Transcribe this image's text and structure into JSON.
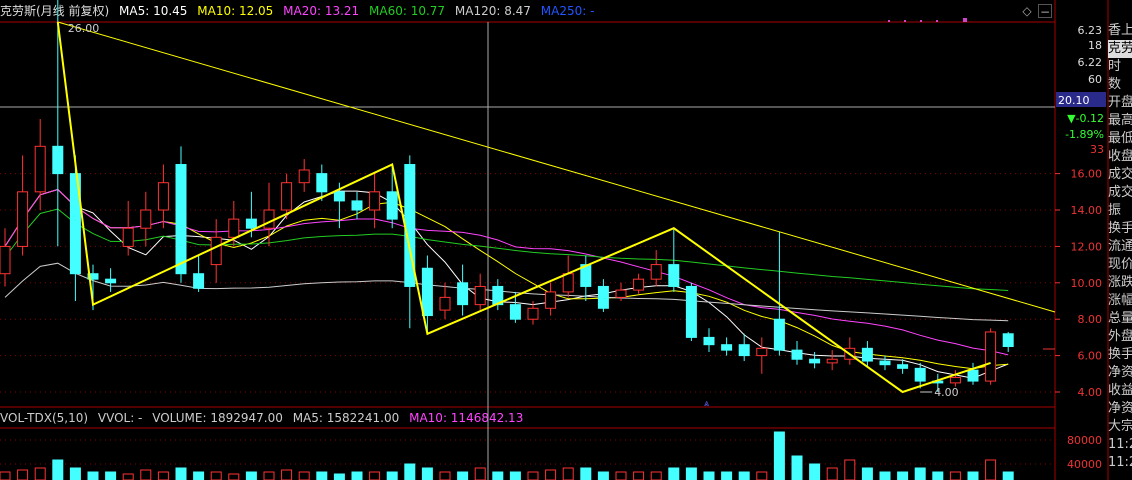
{
  "header": {
    "title": "克劳斯(月线 前复权)",
    "ma5": "MA5: 10.45",
    "ma10": "MA10: 12.05",
    "ma20": "MA20: 13.21",
    "ma60": "MA60: 10.77",
    "ma120": "MA120: 8.47",
    "ma250": "MA250: -"
  },
  "volume_header": {
    "indicator": "VOL-TDX(5,10)",
    "vvol": "VVOL: -",
    "volume": "VOLUME: 1892947.00",
    "ma5": "MA5: 1582241.00",
    "ma10": "MA10: 1146842.13"
  },
  "price_axis": {
    "top1": "6.23",
    "top2": "18",
    "top3": "6.22",
    "top4": "60",
    "current": "20.10",
    "change": "▼-0.12",
    "change_pct": "-1.89%",
    "change_num": "33",
    "ticks": [
      "16.00",
      "14.00",
      "12.00",
      "10.00",
      "8.00",
      "6.00",
      "4.00"
    ]
  },
  "vol_axis": {
    "ticks": [
      "80000",
      "40000"
    ]
  },
  "annotations": {
    "high": "26.00",
    "low": "4.00"
  },
  "right_panel": [
    "香上",
    "克劳",
    "时",
    "数",
    "开盘",
    "最高",
    "最低",
    "收盘",
    "成交",
    "成交",
    "振",
    "换手",
    "流通",
    "现价",
    "涨跌",
    "涨幅",
    "总量",
    "外盘",
    "换手",
    "净资",
    "收益",
    "净资",
    "大宗",
    "11:2",
    "11:2"
  ],
  "colors": {
    "ma5": "#ffffff",
    "ma10": "#ffff00",
    "ma20": "#ff44ff",
    "ma60": "#22cc22",
    "ma120": "#cccccc",
    "ma250": "#2255ff",
    "up": "#ff3333",
    "down": "#44ffff"
  },
  "chart_data": {
    "type": "candlestick",
    "series": [
      {
        "o": 10.5,
        "c": 12.0,
        "h": 13.0,
        "l": 9.8
      },
      {
        "o": 12.0,
        "c": 15.0,
        "h": 17.0,
        "l": 11.5
      },
      {
        "o": 15.0,
        "c": 17.5,
        "h": 19.0,
        "l": 14.0
      },
      {
        "o": 17.5,
        "c": 16.0,
        "h": 26.0,
        "l": 12.0
      },
      {
        "o": 16.0,
        "c": 10.5,
        "h": 17.0,
        "l": 9.0
      },
      {
        "o": 10.5,
        "c": 10.2,
        "h": 11.0,
        "l": 8.5
      },
      {
        "o": 10.2,
        "c": 10.0,
        "h": 10.8,
        "l": 9.5
      },
      {
        "o": 12.0,
        "c": 13.0,
        "h": 14.5,
        "l": 11.5
      },
      {
        "o": 13.0,
        "c": 14.0,
        "h": 15.0,
        "l": 12.0
      },
      {
        "o": 14.0,
        "c": 15.5,
        "h": 16.5,
        "l": 13.0
      },
      {
        "o": 16.5,
        "c": 10.5,
        "h": 17.5,
        "l": 10.0
      },
      {
        "o": 10.5,
        "c": 9.7,
        "h": 11.5,
        "l": 9.5
      },
      {
        "o": 11.0,
        "c": 12.5,
        "h": 13.5,
        "l": 10.0
      },
      {
        "o": 12.5,
        "c": 13.5,
        "h": 14.5,
        "l": 12.0
      },
      {
        "o": 13.5,
        "c": 13.0,
        "h": 15.0,
        "l": 12.5
      },
      {
        "o": 13.0,
        "c": 14.0,
        "h": 15.5,
        "l": 12.0
      },
      {
        "o": 14.0,
        "c": 15.5,
        "h": 16.0,
        "l": 13.5
      },
      {
        "o": 15.5,
        "c": 16.2,
        "h": 16.8,
        "l": 15.0
      },
      {
        "o": 16.0,
        "c": 15.0,
        "h": 16.5,
        "l": 14.5
      },
      {
        "o": 15.0,
        "c": 14.5,
        "h": 15.5,
        "l": 13.0
      },
      {
        "o": 14.5,
        "c": 14.0,
        "h": 15.0,
        "l": 13.5
      },
      {
        "o": 14.0,
        "c": 15.0,
        "h": 16.0,
        "l": 13.0
      },
      {
        "o": 15.0,
        "c": 13.5,
        "h": 16.5,
        "l": 13.0
      },
      {
        "o": 16.5,
        "c": 9.8,
        "h": 17.0,
        "l": 7.5
      },
      {
        "o": 10.8,
        "c": 8.2,
        "h": 11.5,
        "l": 7.2
      },
      {
        "o": 8.5,
        "c": 9.2,
        "h": 10.0,
        "l": 8.0
      },
      {
        "o": 10.0,
        "c": 8.8,
        "h": 11.0,
        "l": 8.2
      },
      {
        "o": 8.8,
        "c": 9.8,
        "h": 10.5,
        "l": 8.5
      },
      {
        "o": 9.8,
        "c": 8.8,
        "h": 10.2,
        "l": 8.5
      },
      {
        "o": 8.8,
        "c": 8.0,
        "h": 9.5,
        "l": 7.8
      },
      {
        "o": 8.0,
        "c": 8.6,
        "h": 9.0,
        "l": 7.7
      },
      {
        "o": 8.6,
        "c": 9.5,
        "h": 10.0,
        "l": 8.2
      },
      {
        "o": 9.5,
        "c": 10.5,
        "h": 11.5,
        "l": 9.2
      },
      {
        "o": 11.0,
        "c": 9.8,
        "h": 11.5,
        "l": 9.0
      },
      {
        "o": 9.8,
        "c": 8.6,
        "h": 10.2,
        "l": 8.4
      },
      {
        "o": 9.2,
        "c": 9.6,
        "h": 10.0,
        "l": 9.0
      },
      {
        "o": 9.6,
        "c": 10.2,
        "h": 10.5,
        "l": 9.4
      },
      {
        "o": 10.2,
        "c": 11.0,
        "h": 11.8,
        "l": 9.8
      },
      {
        "o": 11.0,
        "c": 9.8,
        "h": 13.0,
        "l": 9.5
      },
      {
        "o": 9.8,
        "c": 7.0,
        "h": 10.0,
        "l": 6.8
      },
      {
        "o": 7.0,
        "c": 6.6,
        "h": 7.5,
        "l": 6.2
      },
      {
        "o": 6.6,
        "c": 6.3,
        "h": 7.0,
        "l": 6.0
      },
      {
        "o": 6.6,
        "c": 6.0,
        "h": 7.2,
        "l": 5.7
      },
      {
        "o": 6.0,
        "c": 6.4,
        "h": 7.0,
        "l": 5.0
      },
      {
        "o": 8.0,
        "c": 6.3,
        "h": 12.8,
        "l": 6.0
      },
      {
        "o": 6.3,
        "c": 5.8,
        "h": 6.8,
        "l": 5.5
      },
      {
        "o": 5.8,
        "c": 5.6,
        "h": 6.2,
        "l": 5.3
      },
      {
        "o": 5.6,
        "c": 5.8,
        "h": 6.3,
        "l": 5.2
      },
      {
        "o": 5.8,
        "c": 6.4,
        "h": 7.0,
        "l": 5.5
      },
      {
        "o": 6.4,
        "c": 5.7,
        "h": 6.8,
        "l": 5.4
      },
      {
        "o": 5.7,
        "c": 5.5,
        "h": 6.0,
        "l": 5.2
      },
      {
        "o": 5.5,
        "c": 5.3,
        "h": 5.8,
        "l": 5.0
      },
      {
        "o": 5.3,
        "c": 4.6,
        "h": 5.6,
        "l": 4.2
      },
      {
        "o": 4.6,
        "c": 4.5,
        "h": 5.0,
        "l": 4.0
      },
      {
        "o": 4.5,
        "c": 4.8,
        "h": 5.2,
        "l": 4.3
      },
      {
        "o": 5.2,
        "c": 4.6,
        "h": 5.6,
        "l": 4.4
      },
      {
        "o": 4.6,
        "c": 7.3,
        "h": 7.5,
        "l": 4.4
      },
      {
        "o": 7.2,
        "c": 6.5,
        "h": 7.3,
        "l": 6.2
      }
    ],
    "ylim": [
      3.0,
      20.5
    ],
    "trend_line": [
      [
        3,
        26.0
      ],
      [
        51,
        10.3
      ]
    ],
    "zigzag": [
      [
        3,
        25.5
      ],
      [
        5,
        8.8
      ],
      [
        22,
        16.5
      ],
      [
        24,
        7.2
      ],
      [
        38,
        13.0
      ],
      [
        51,
        4.0
      ],
      [
        56,
        5.6
      ]
    ],
    "volume": [
      2,
      2.5,
      3,
      5,
      3,
      2,
      2,
      1.5,
      2.5,
      2,
      3,
      2,
      2,
      1.5,
      2,
      2,
      2.5,
      2,
      2,
      1.5,
      2,
      2,
      2,
      4,
      3,
      2,
      2,
      3,
      2,
      2,
      2,
      2.5,
      3,
      3,
      2,
      2,
      2,
      2,
      3,
      3,
      2,
      2,
      2,
      2,
      12,
      6,
      4,
      3,
      5,
      3,
      2,
      2,
      3,
      2,
      2,
      2,
      5,
      2
    ]
  }
}
